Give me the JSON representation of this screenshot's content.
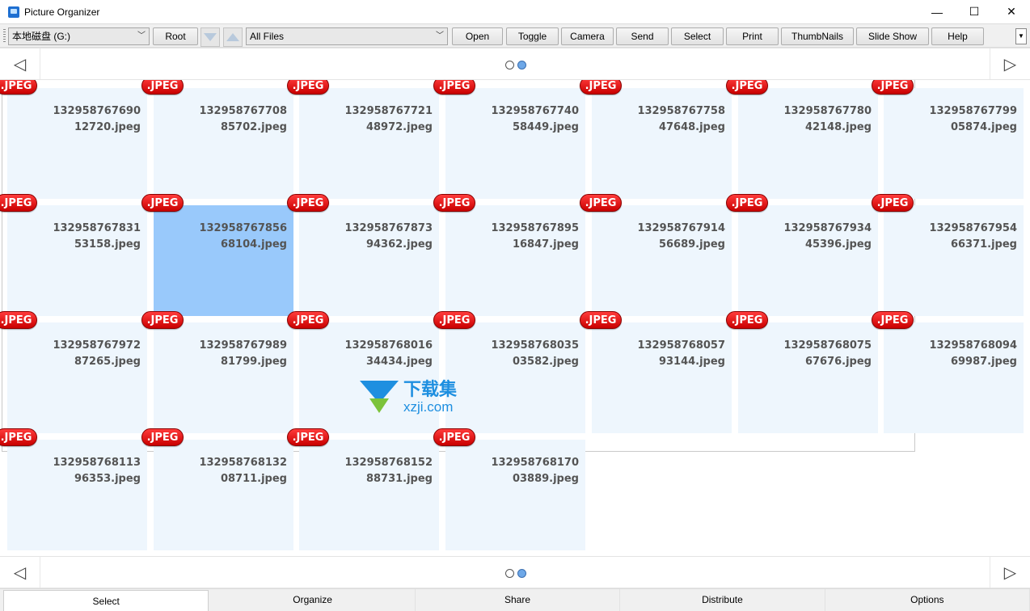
{
  "window": {
    "title": "Picture Organizer",
    "minimize": "—",
    "maximize": "☐",
    "close": "✕"
  },
  "toolbar": {
    "drive": "本地磁盘 (G:)",
    "filter": "All Files",
    "buttons": [
      "Root",
      "Open",
      "Toggle",
      "Camera",
      "Send",
      "Select",
      "Print",
      "ThumbNails",
      "Slide Show",
      "Help"
    ],
    "overflow": "▼"
  },
  "nav": {
    "prev": "◁",
    "next": "▷",
    "pages": 2,
    "current_page": 2
  },
  "badge_label": ".JPEG",
  "files": [
    "132958767690\n12720.jpeg",
    "132958767708\n85702.jpeg",
    "132958767721\n48972.jpeg",
    "132958767740\n58449.jpeg",
    "132958767758\n47648.jpeg",
    "132958767780\n42148.jpeg",
    "132958767799\n05874.jpeg",
    "132958767831\n53158.jpeg",
    "132958767856\n68104.jpeg",
    "132958767873\n94362.jpeg",
    "132958767895\n16847.jpeg",
    "132958767914\n56689.jpeg",
    "132958767934\n45396.jpeg",
    "132958767954\n66371.jpeg",
    "132958767972\n87265.jpeg",
    "132958767989\n81799.jpeg",
    "132958768016\n34434.jpeg",
    "132958768035\n03582.jpeg",
    "132958768057\n93144.jpeg",
    "132958768075\n67676.jpeg",
    "132958768094\n69987.jpeg",
    "132958768113\n96353.jpeg",
    "132958768132\n08711.jpeg",
    "132958768152\n88731.jpeg",
    "132958768170\n03889.jpeg"
  ],
  "selected_index": 8,
  "watermark": {
    "cn": "下载集",
    "url": "xzji.com"
  },
  "bottom_tabs": [
    "Select",
    "Organize",
    "Share",
    "Distribute",
    "Options"
  ],
  "active_tab": 0
}
